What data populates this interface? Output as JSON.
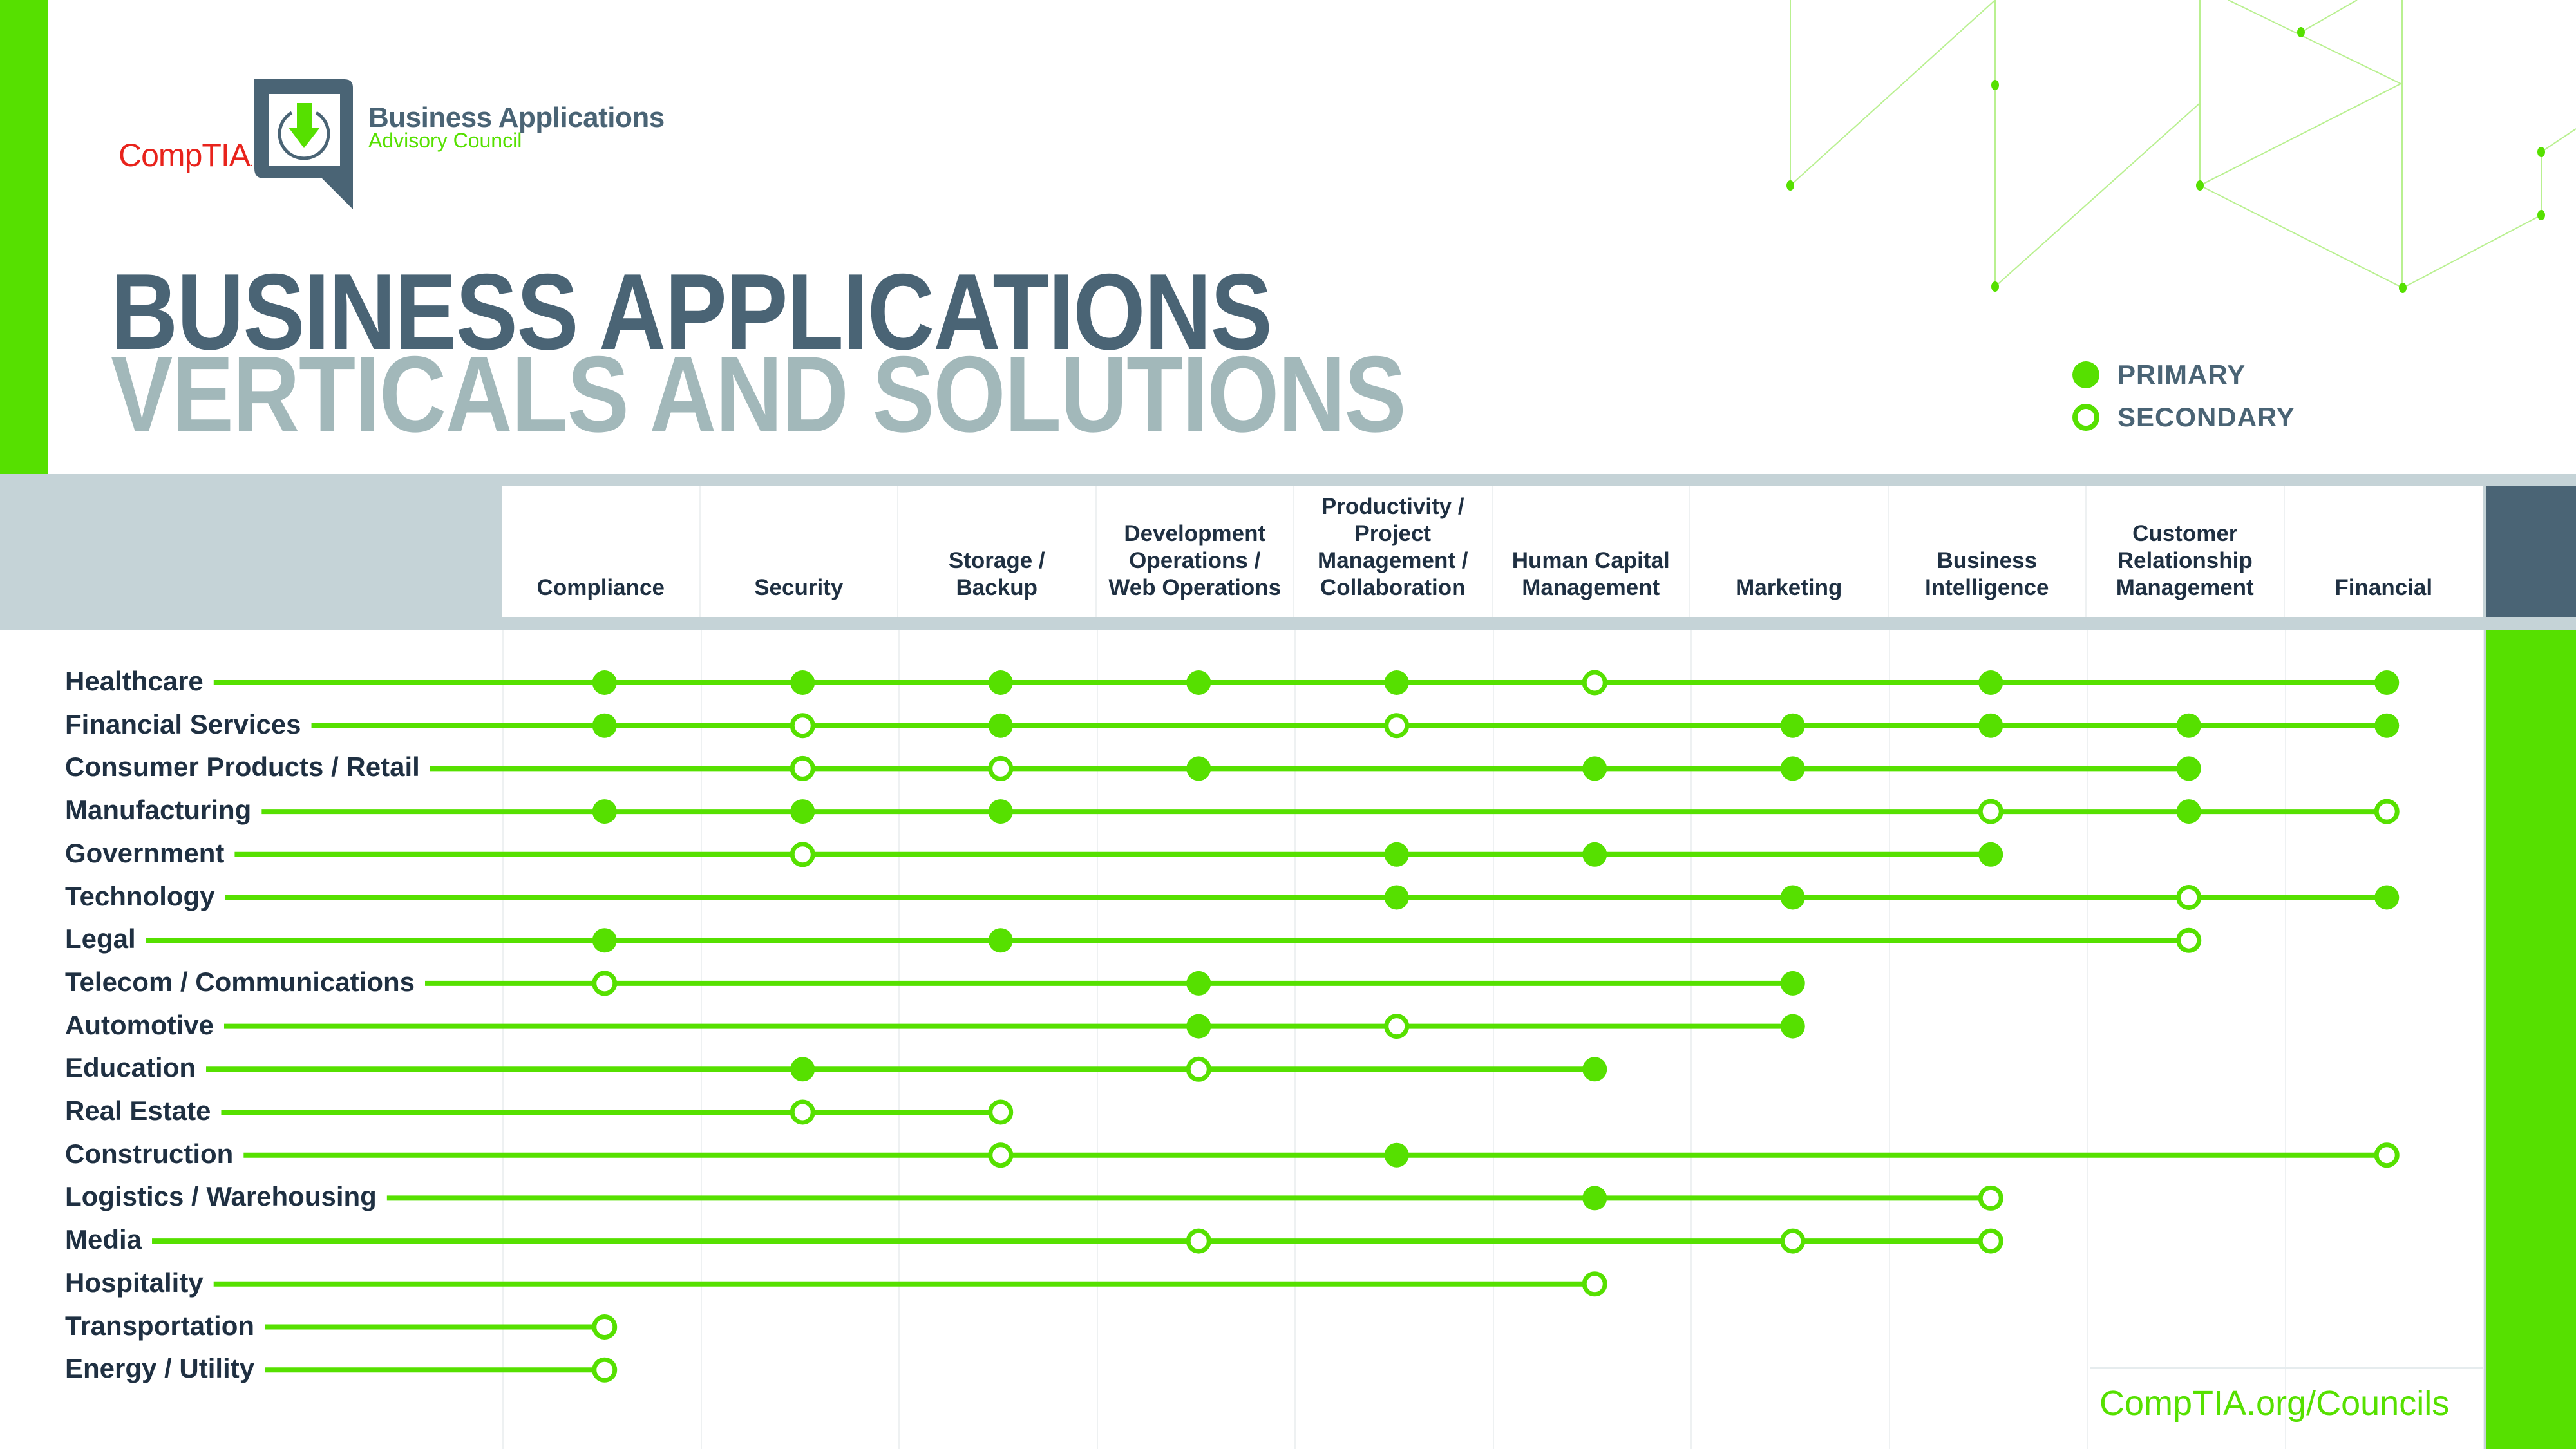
{
  "logo": {
    "brand": "CompTIA",
    "brand_mark": ".",
    "council_name": "Business Applications",
    "council_sub": "Advisory Council",
    "icon": "download-power-icon"
  },
  "title": {
    "line1": "BUSINESS APPLICATIONS",
    "line2": "VERTICALS AND SOLUTIONS"
  },
  "legend": {
    "primary": "PRIMARY",
    "secondary": "SECONDARY"
  },
  "footer": {
    "url": "CompTIA.org/Councils"
  },
  "colors": {
    "accent_green": "#56e000",
    "slate": "#4a6475",
    "light_slate": "#a2b8ba",
    "band_gray": "#c5d3d7",
    "text_dark": "#1f3042",
    "brand_red": "#e8231c"
  },
  "chart_data": {
    "type": "table",
    "title": "Business Applications Verticals and Solutions",
    "legend": [
      {
        "key": "P",
        "label": "PRIMARY",
        "marker": "filled-circle"
      },
      {
        "key": "S",
        "label": "SECONDARY",
        "marker": "hollow-circle"
      }
    ],
    "legend_position": "top-right",
    "columns": [
      {
        "key": "compliance",
        "lines": [
          "Compliance"
        ]
      },
      {
        "key": "security",
        "lines": [
          "Security"
        ]
      },
      {
        "key": "storage",
        "lines": [
          "Storage /",
          "Backup"
        ]
      },
      {
        "key": "devops",
        "lines": [
          "Development",
          "Operations /",
          "Web Operations"
        ]
      },
      {
        "key": "productivity",
        "lines": [
          "Productivity /",
          "Project",
          "Management /",
          "Collaboration"
        ]
      },
      {
        "key": "hcm",
        "lines": [
          "Human Capital",
          "Management"
        ]
      },
      {
        "key": "marketing",
        "lines": [
          "Marketing"
        ]
      },
      {
        "key": "bi",
        "lines": [
          "Business",
          "Intelligence"
        ]
      },
      {
        "key": "crm",
        "lines": [
          "Customer",
          "Relationship",
          "Management"
        ]
      },
      {
        "key": "financial",
        "lines": [
          "Financial"
        ]
      }
    ],
    "rows": [
      {
        "label": "Healthcare",
        "values": [
          "P",
          "P",
          "P",
          "P",
          "P",
          "S",
          "",
          "P",
          "",
          "P"
        ]
      },
      {
        "label": "Financial Services",
        "values": [
          "P",
          "S",
          "P",
          "",
          "S",
          "",
          "P",
          "P",
          "P",
          "P"
        ]
      },
      {
        "label": "Consumer Products / Retail",
        "values": [
          "",
          "S",
          "S",
          "P",
          "",
          "P",
          "P",
          "",
          "P",
          ""
        ]
      },
      {
        "label": "Manufacturing",
        "values": [
          "P",
          "P",
          "P",
          "",
          "",
          "",
          "",
          "S",
          "P",
          "S"
        ]
      },
      {
        "label": "Government",
        "values": [
          "",
          "S",
          "",
          "",
          "P",
          "P",
          "",
          "P",
          "",
          ""
        ]
      },
      {
        "label": "Technology",
        "values": [
          "",
          "",
          "",
          "",
          "P",
          "",
          "P",
          "",
          "S",
          "P"
        ]
      },
      {
        "label": "Legal",
        "values": [
          "P",
          "",
          "P",
          "",
          "",
          "",
          "",
          "",
          "S",
          ""
        ]
      },
      {
        "label": "Telecom / Communications",
        "values": [
          "S",
          "",
          "",
          "P",
          "",
          "",
          "P",
          "",
          "",
          ""
        ]
      },
      {
        "label": "Automotive",
        "values": [
          "",
          "",
          "",
          "P",
          "S",
          "",
          "P",
          "",
          "",
          ""
        ]
      },
      {
        "label": "Education",
        "values": [
          "",
          "P",
          "",
          "S",
          "",
          "P",
          "",
          "",
          "",
          ""
        ]
      },
      {
        "label": "Real Estate",
        "values": [
          "",
          "S",
          "S",
          "",
          "",
          "",
          "",
          "",
          "",
          ""
        ]
      },
      {
        "label": "Construction",
        "values": [
          "",
          "",
          "S",
          "",
          "P",
          "",
          "",
          "",
          "",
          "S"
        ]
      },
      {
        "label": "Logistics / Warehousing",
        "values": [
          "",
          "",
          "",
          "",
          "",
          "P",
          "",
          "S",
          "",
          ""
        ]
      },
      {
        "label": "Media",
        "values": [
          "",
          "",
          "",
          "S",
          "",
          "",
          "S",
          "S",
          "",
          ""
        ]
      },
      {
        "label": "Hospitality",
        "values": [
          "",
          "",
          "",
          "",
          "",
          "S",
          "",
          "",
          "",
          ""
        ]
      },
      {
        "label": "Transportation",
        "values": [
          "S",
          "",
          "",
          "",
          "",
          "",
          "",
          "",
          "",
          ""
        ]
      },
      {
        "label": "Energy / Utility",
        "values": [
          "S",
          "",
          "",
          "",
          "",
          "",
          "",
          "",
          "",
          ""
        ]
      }
    ]
  }
}
